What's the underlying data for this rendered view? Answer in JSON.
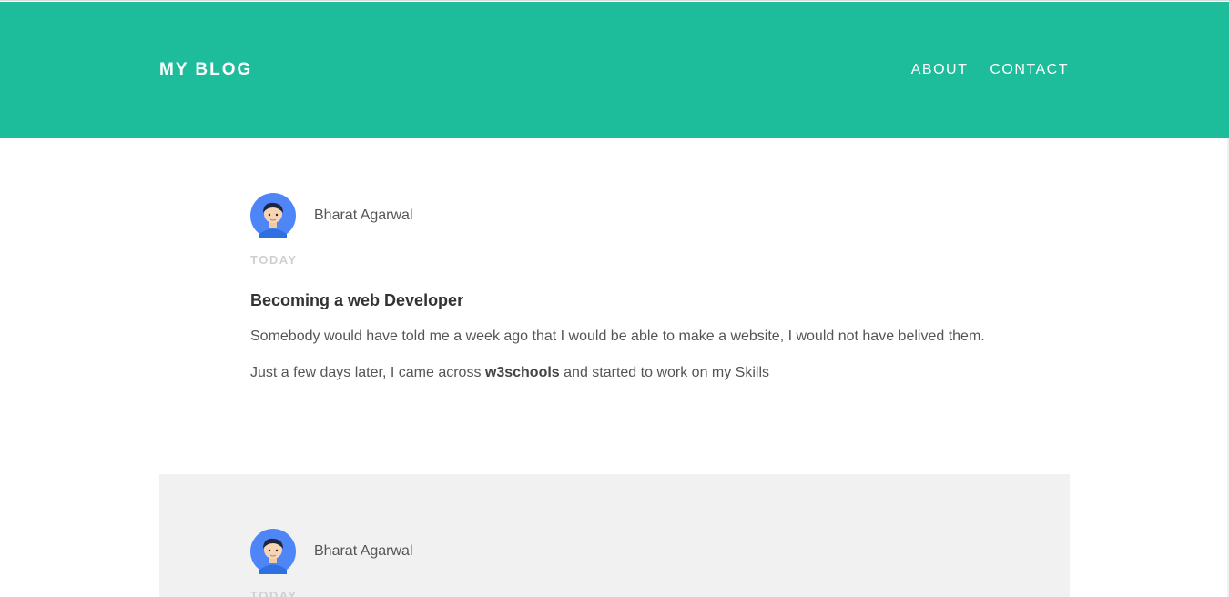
{
  "header": {
    "brand": "MY BLOG",
    "nav": [
      "ABOUT",
      "CONTACT"
    ],
    "background_color": "#1dbd9b"
  },
  "posts": [
    {
      "author": "Bharat Agarwal",
      "avatar_icon": "user-avatar-icon",
      "date": "TODAY",
      "title": "Becoming a web Developer",
      "paragraph_1": "Somebody would have told me a week ago that I would be able to make a website, I would not have belived them.",
      "paragraph_2_before": "Just a few days later, I came across ",
      "paragraph_2_bold": "w3schools",
      "paragraph_2_after": " and started to work on my Skills"
    },
    {
      "author": "Bharat Agarwal",
      "avatar_icon": "user-avatar-icon",
      "date": "TODAY",
      "card_color": "#f1f1f1"
    }
  ]
}
